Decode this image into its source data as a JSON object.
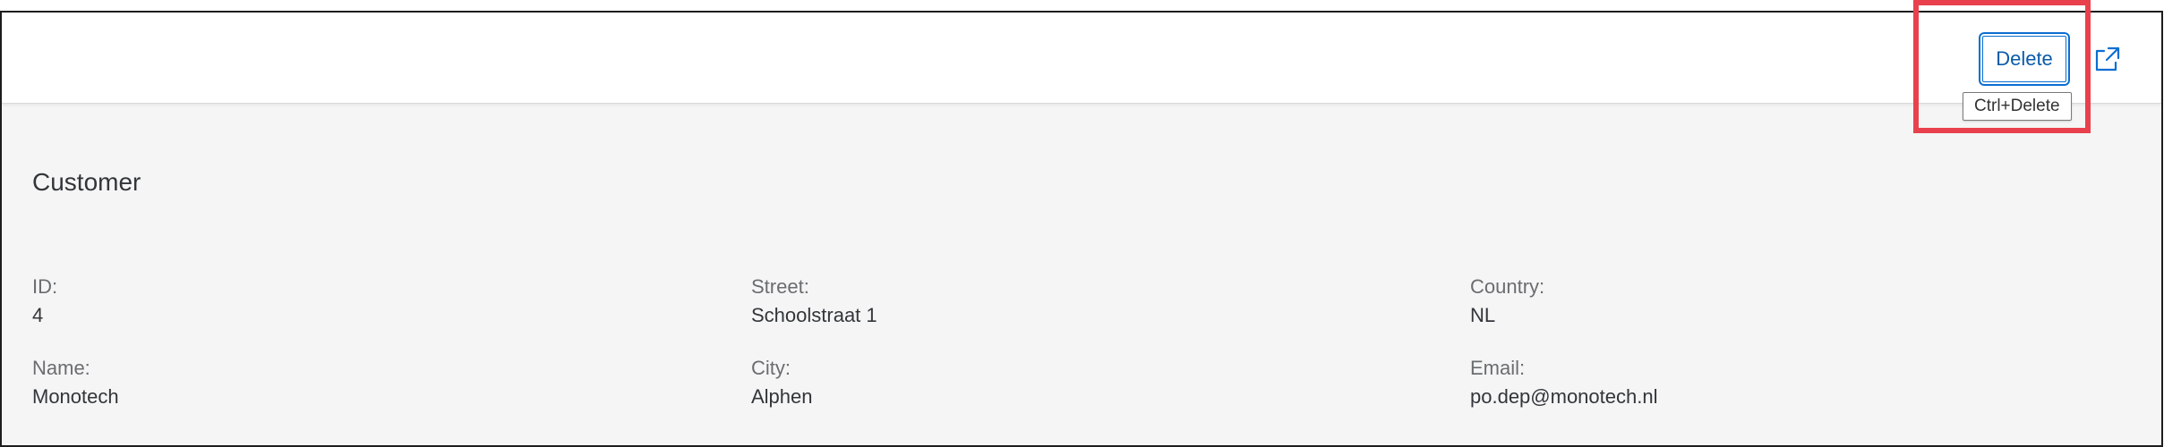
{
  "toolbar": {
    "delete_label": "Delete",
    "delete_tooltip": "Ctrl+Delete",
    "share_icon": "share-icon"
  },
  "section": {
    "title": "Customer"
  },
  "fields": {
    "id": {
      "label": "ID:",
      "value": "4"
    },
    "name": {
      "label": "Name:",
      "value": "Monotech"
    },
    "street": {
      "label": "Street:",
      "value": "Schoolstraat 1"
    },
    "city": {
      "label": "City:",
      "value": "Alphen"
    },
    "country": {
      "label": "Country:",
      "value": "NL"
    },
    "email": {
      "label": "Email:",
      "value": "po.dep@monotech.nl"
    }
  },
  "colors": {
    "accent": "#0a6ed1",
    "highlight": "#e8414d",
    "background": "#f5f5f5"
  }
}
